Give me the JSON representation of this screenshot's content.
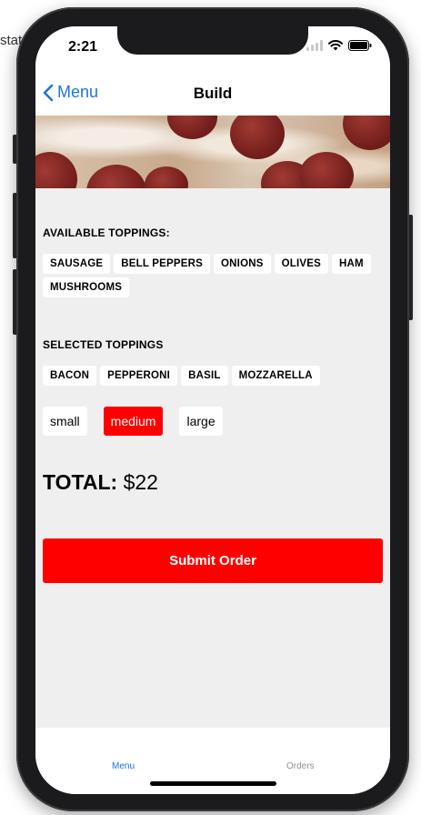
{
  "background_text": "stat",
  "status_bar": {
    "time": "2:21"
  },
  "nav": {
    "back_label": "Menu",
    "title": "Build"
  },
  "available": {
    "title": "AVAILABLE TOPPINGS:",
    "items": [
      "SAUSAGE",
      "BELL PEPPERS",
      "ONIONS",
      "OLIVES",
      "HAM",
      "MUSHROOMS"
    ]
  },
  "selected": {
    "title": "SELECTED TOPPINGS",
    "items": [
      "BACON",
      "PEPPERONI",
      "BASIL",
      "MOZZARELLA"
    ]
  },
  "sizes": {
    "options": [
      "small",
      "medium",
      "large"
    ],
    "selected": "medium"
  },
  "total": {
    "label": "TOTAL:",
    "value": "$22"
  },
  "submit_label": "Submit Order",
  "tabs": {
    "menu": "Menu",
    "orders": "Orders"
  },
  "colors": {
    "accent": "#ff0000",
    "link": "#1a73e8",
    "screen_bg": "#efefef"
  }
}
